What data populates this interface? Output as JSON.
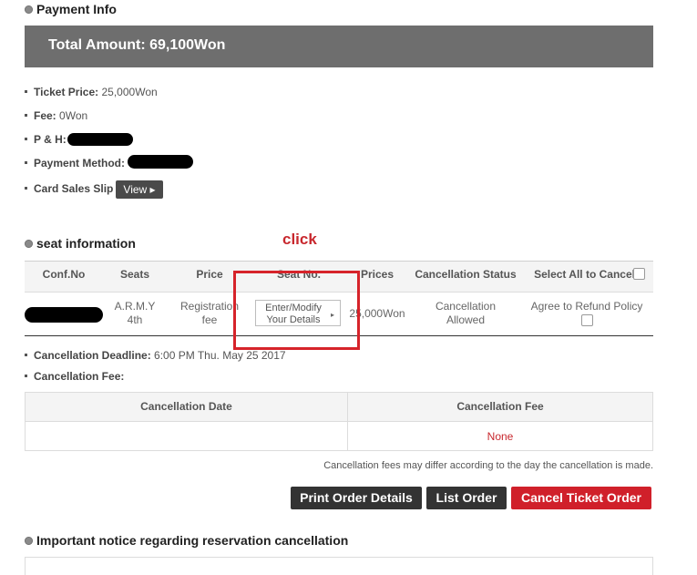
{
  "payment": {
    "section_title": "Payment Info",
    "total_amount": "Total Amount: 69,100Won",
    "ticket_price_label": "Ticket Price:",
    "ticket_price_value": "25,000Won",
    "fee_label": "Fee:",
    "fee_value": "0Won",
    "ph_label": "P & H:",
    "method_label": "Payment Method:",
    "slip_label": "Card Sales Slip",
    "view_button": "View ▸"
  },
  "annotation": {
    "click_label": "click"
  },
  "seat": {
    "section_title": "seat information",
    "headers": [
      "Conf.No",
      "Seats",
      "Price",
      "Seat No.",
      "Prices",
      "Cancellation Status",
      "Select All to Cancel"
    ],
    "row": {
      "seat_line1": "A.R.M.Y",
      "seat_line2": "4th",
      "price_line1": "Registration",
      "price_line2": "fee",
      "enter_line1": "Enter/Modify",
      "enter_line2": "Your Details",
      "prices": "25,000Won",
      "status_line1": "Cancellation",
      "status_line2": "Allowed",
      "agree": "Agree to Refund Policy"
    }
  },
  "cancellation": {
    "deadline_label": "Cancellation Deadline:",
    "deadline_value": "6:00 PM Thu. May 25 2017",
    "fee_label": "Cancellation Fee:",
    "table_headers": [
      "Cancellation Date",
      "Cancellation Fee"
    ],
    "fee_value": "None",
    "note": "Cancellation fees may differ according to the day the cancellation is made."
  },
  "actions": {
    "print": "Print Order Details",
    "list": "List Order",
    "cancel": "Cancel Ticket Order"
  },
  "notice": {
    "title": "Important notice regarding reservation cancellation"
  },
  "colors": {
    "accent_red": "#c8282e",
    "dark_button": "#333333",
    "cancel_button": "#d0202a"
  }
}
